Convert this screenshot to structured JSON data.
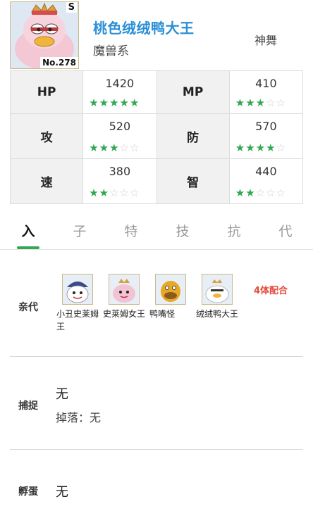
{
  "monster": {
    "rank": "S",
    "number": "No.278",
    "name": "桃色绒绒鸭大王",
    "family": "魔兽系",
    "skill": "神舞"
  },
  "stats": [
    {
      "label": "HP",
      "value": "1420",
      "stars": 5
    },
    {
      "label": "MP",
      "value": "410",
      "stars": 3
    },
    {
      "label": "攻",
      "value": "520",
      "stars": 3
    },
    {
      "label": "防",
      "value": "570",
      "stars": 4
    },
    {
      "label": "速",
      "value": "380",
      "stars": 2
    },
    {
      "label": "智",
      "value": "440",
      "stars": 2
    }
  ],
  "tabs": [
    {
      "label": "入"
    },
    {
      "label": "子"
    },
    {
      "label": "特"
    },
    {
      "label": "技"
    },
    {
      "label": "抗"
    },
    {
      "label": "代"
    }
  ],
  "parents_section": {
    "label": "亲代",
    "combo": "4体配合",
    "parents": [
      {
        "name": "小丑史莱姆王"
      },
      {
        "name": "史莱姆女王"
      },
      {
        "name": "鸭嘴怪"
      },
      {
        "name": "绒绒鸭大王"
      }
    ]
  },
  "capture": {
    "label": "捕捉",
    "value": "无",
    "drop": "掉落：无"
  },
  "hatch": {
    "label": "孵蛋",
    "value": "无"
  },
  "colors": {
    "accent_green": "#33a853",
    "name_blue": "#2b8fd6",
    "combo_red": "#e24a3b"
  }
}
